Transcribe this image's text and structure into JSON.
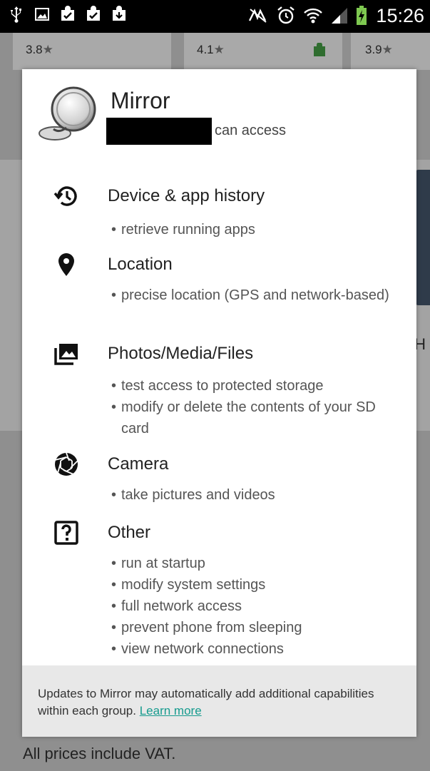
{
  "status_bar": {
    "time": "15:26",
    "left_icons": [
      "usb-icon",
      "image-notification-icon",
      "store-update-icon",
      "store-update-icon",
      "store-update-icon"
    ],
    "right_icons": [
      "nfc-mute-icon",
      "alarm-icon",
      "wifi-icon",
      "signal-icon",
      "battery-charging-icon"
    ]
  },
  "background": {
    "ratings": [
      "3.8",
      "4.1",
      "3.9"
    ],
    "partial_letter": "H",
    "footer": "All prices include VAT."
  },
  "dialog": {
    "app_name": "Mirror",
    "can_access": "can access",
    "groups": [
      {
        "title": "Device & app history",
        "icon": "history-icon",
        "items": [
          "retrieve running apps"
        ]
      },
      {
        "title": "Location",
        "icon": "location-pin-icon",
        "items": [
          "precise location (GPS and network-based)"
        ]
      },
      {
        "title": "Photos/Media/Files",
        "icon": "photos-media-icon",
        "items": [
          "test access to protected storage",
          "modify or delete the contents of your SD card"
        ]
      },
      {
        "title": "Camera",
        "icon": "camera-aperture-icon",
        "items": [
          "take pictures and videos"
        ]
      },
      {
        "title": "Other",
        "icon": "question-box-icon",
        "items": [
          "run at startup",
          "modify system settings",
          "full network access",
          "prevent phone from sleeping",
          "view network connections"
        ]
      }
    ],
    "footer_text": "Updates to Mirror may automatically add additional capabilities within each group.",
    "learn_more": "Learn more"
  }
}
